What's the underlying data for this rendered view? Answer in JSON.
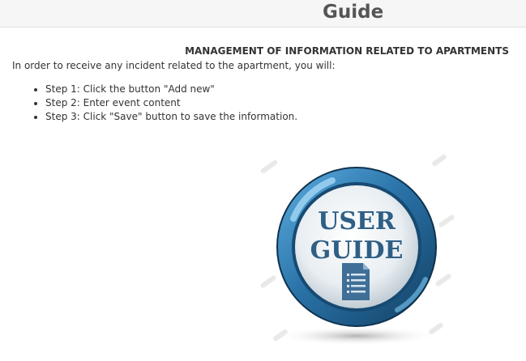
{
  "header": {
    "title": "Guide"
  },
  "content": {
    "heading": "MANAGEMENT OF INFORMATION RELATED TO APARTMENTS",
    "intro": "In order to receive any incident related to the apartment, you will:",
    "steps": [
      "Step 1: Click the button \"Add new\"",
      "Step 2: Enter event content",
      "Step 3: Click \"Save\" button to save the information."
    ]
  },
  "illustration": {
    "line1": "USER",
    "line2": "GUIDE",
    "icon": "document-icon",
    "colors": {
      "ring": "#2a73a8",
      "ring_dark": "#123f63",
      "text": "#2f5f85"
    }
  }
}
